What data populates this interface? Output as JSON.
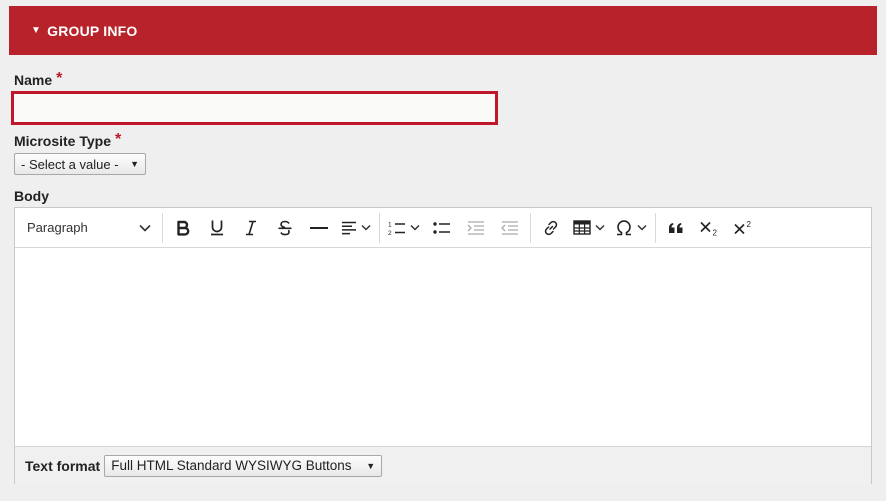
{
  "group": {
    "title": "GROUP INFO",
    "toggle": "▼"
  },
  "fields": {
    "name": {
      "label": "Name",
      "required": "*",
      "value": ""
    },
    "microsite_type": {
      "label": "Microsite Type",
      "required": "*",
      "selected": "- Select a value -"
    },
    "body": {
      "label": "Body"
    }
  },
  "toolbar": {
    "paragraph": "Paragraph",
    "buttons": [
      "bold",
      "underline",
      "italic",
      "strikethrough",
      "horizontal-line",
      "align",
      "numbered-list",
      "bulleted-list",
      "outdent",
      "indent",
      "link",
      "table",
      "special-characters",
      "blockquote",
      "subscript",
      "superscript"
    ]
  },
  "text_format": {
    "label": "Text format",
    "selected": "Full HTML Standard WYSIWYG Buttons"
  },
  "colors": {
    "header_bg": "#b8232b",
    "required": "#c0182a",
    "page_bg": "#efefef"
  }
}
